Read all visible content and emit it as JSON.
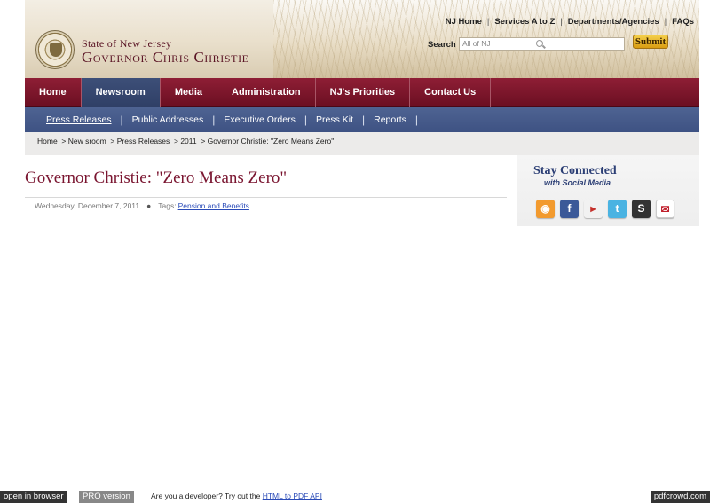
{
  "header": {
    "state_line": "State of New Jersey",
    "governor_line": "Governor Chris Christie",
    "top_links": [
      "NJ Home",
      "Services A to Z",
      "Departments/Agencies",
      "FAQs"
    ],
    "search_label": "Search",
    "search_placeholder": "All of NJ",
    "submit_label": "Submit"
  },
  "main_nav": {
    "items": [
      "Home",
      "Newsroom",
      "Media",
      "Administration",
      "NJ's Priorities",
      "Contact Us"
    ],
    "active": "Newsroom"
  },
  "sub_nav": {
    "items": [
      "Press Releases",
      "Public Addresses",
      "Executive Orders",
      "Press Kit",
      "Reports"
    ],
    "current": "Press Releases"
  },
  "breadcrumb": "Home  > New sroom  > Press Releases  > 2011  > Governor Christie: \"Zero Means Zero\"",
  "article": {
    "title": "Governor Christie: \"Zero Means Zero\"",
    "date": "Wednesday, December 7, 2011",
    "tags_label": "Tags:",
    "tag": "Pension and Benefits"
  },
  "sidebar": {
    "title": "Stay Connected",
    "subtitle": "with Social Media",
    "icons": [
      "rss-icon",
      "facebook-icon",
      "youtube-icon",
      "twitter-icon",
      "scribd-icon",
      "email-icon"
    ]
  },
  "footer": {
    "open_in_browser": "open in browser",
    "pro_version": "PRO version",
    "developer_text": "Are you a developer? Try out the",
    "api_link": "HTML to PDF API",
    "brand": "pdfcrowd.com"
  },
  "colors": {
    "nav_maroon": "#7a1530",
    "nav_active_blue": "#3d4f78",
    "subnav_blue": "#4e6392",
    "title_maroon": "#7a1530"
  }
}
